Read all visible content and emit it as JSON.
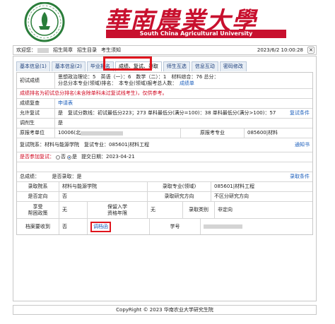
{
  "header": {
    "brand_cn": "華南農業大學",
    "brand_en": "South China Agricultural University"
  },
  "navbar": {
    "welcome": "欢迎您：",
    "links": [
      "招生简章",
      "招生目录",
      "考生须知"
    ],
    "datetime": "2023/6/2 10:00:28",
    "close": "×"
  },
  "tabs": [
    "基本信息(1)",
    "基本信息(2)",
    "毕业报名",
    "成绩、复试、录取",
    "师生互选",
    "信息互动",
    "密码修改"
  ],
  "prelim": {
    "label": "初试成绩",
    "line1": "思想政治理论：5　英语（一）：6　数学（二）：1　材料综合：76  总分：",
    "line2": "分总分本专业(领域)排名：　本专业(领域)报考总人数：",
    "note": "成绩单",
    "warning": "成绩排名为初试总分排名(未含除单科未过复试线考生)，仅供参考。"
  },
  "review": {
    "label": "成绩复查",
    "link": "申请表"
  },
  "retest_allowed": {
    "label": "允许复试",
    "text": "是　复试分数线：初试最低分223；273 单科最低分(满分=100)：38 单科最低分(满分>100)：57",
    "link": "复试条件"
  },
  "adjust": {
    "label": "调剂生",
    "value": "是"
  },
  "origin": {
    "label": "原报考单位",
    "value": "10006(北",
    "major_label": "原报考专业",
    "major_value": "085600|材料"
  },
  "retest_unit": {
    "text": "复试院系：材料与能源学院　复试专业：085601|材料工程",
    "link": "通知书"
  },
  "attend": {
    "label": "是否参加复试：",
    "no": "否",
    "yes": "是",
    "date": "提交日期：2023-04-21"
  },
  "total": {
    "label": "总成绩：",
    "admitted": "是否录取：是",
    "link": "录取条件"
  },
  "admission": {
    "dept_label": "录取院系",
    "dept_value": "材料与能源学院",
    "major_label": "录取专业(领域)",
    "major_value": "085601|材料工程",
    "orient_label": "是否定向",
    "orient_value": "否",
    "research_label": "录取研究方向",
    "research_value": "不区分研究方向",
    "help_label": "享受\n帮困政策",
    "help_value": "无",
    "exempt_label": "保留入学\n资格年限",
    "exempt_value": "无",
    "category_label": "录取类别",
    "category_value": "非定向",
    "archive_label": "档案要收到",
    "archive_value": "否",
    "archive_link": "调档函",
    "id_label": "学号"
  },
  "footer": {
    "text": "CopyRight © 2023 华南农业大学研究生院"
  },
  "colors": {
    "brand_red": "#c8102e",
    "link_blue": "#1a5dbb",
    "warning_red": "#d0021b",
    "highlight_red": "#e0151d"
  }
}
